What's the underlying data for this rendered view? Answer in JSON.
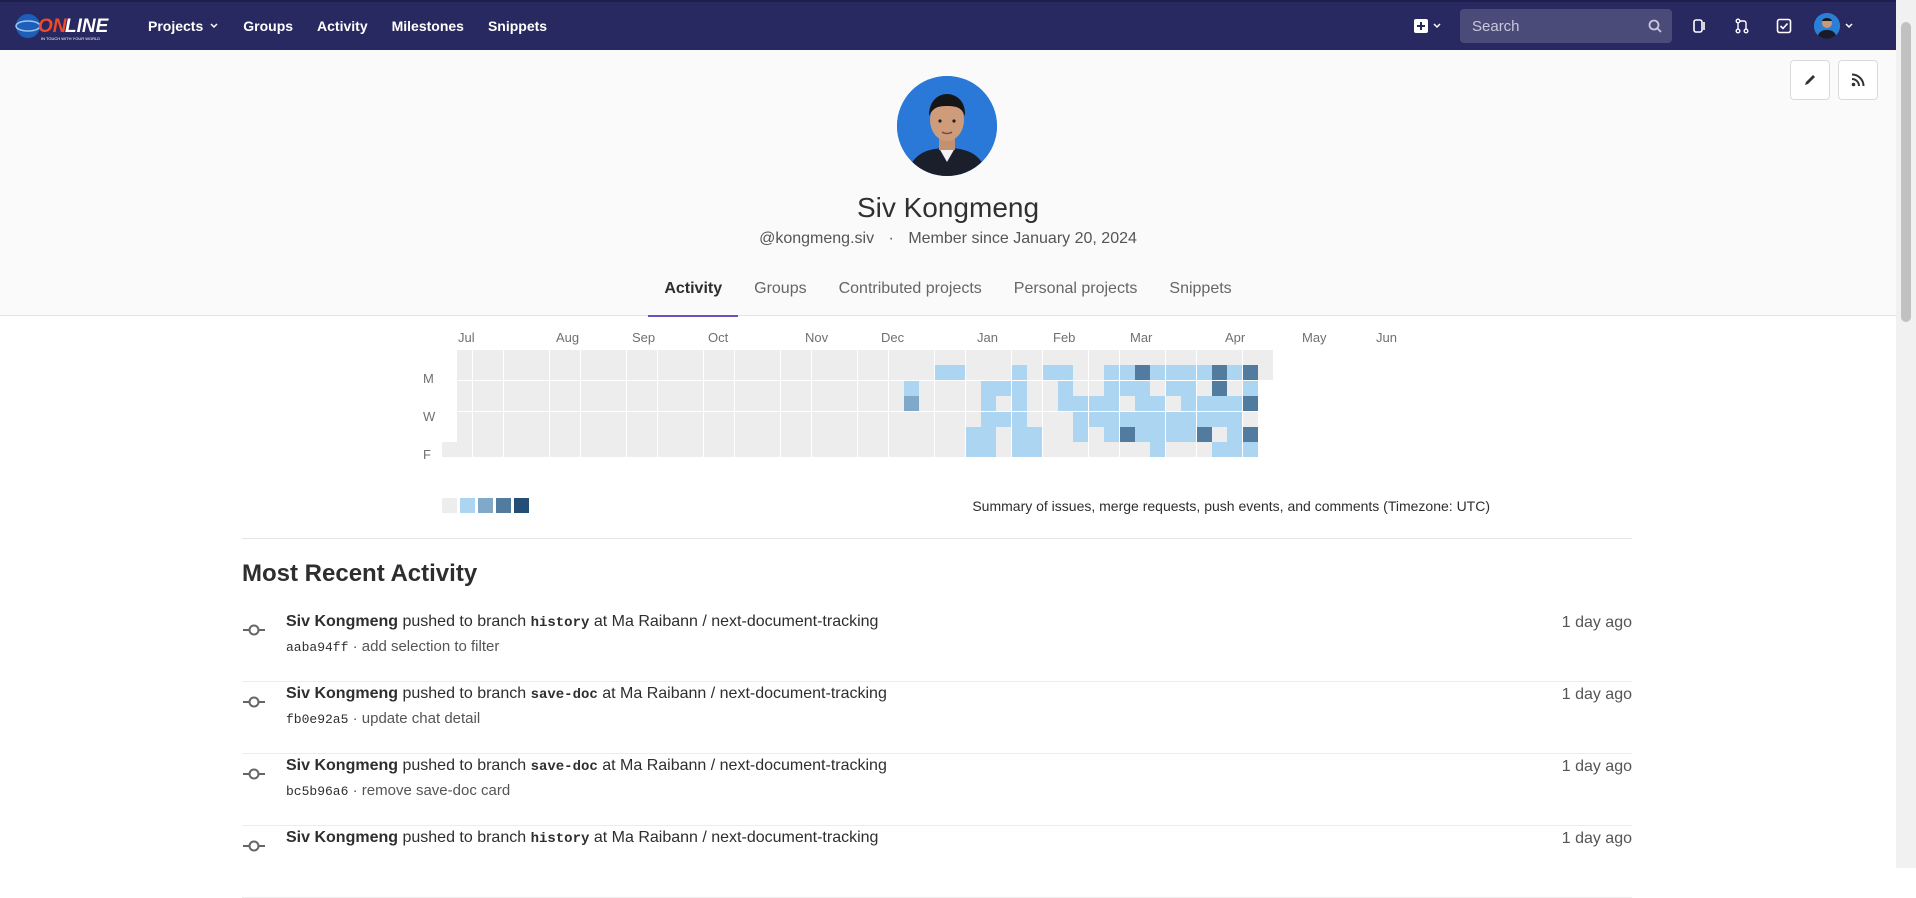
{
  "header": {
    "logo_text": "ONLINE",
    "logo_tagline": "IN TOUCH WITH YOUR WORLD",
    "nav": [
      {
        "label": "Projects",
        "dropdown": true
      },
      {
        "label": "Groups"
      },
      {
        "label": "Activity"
      },
      {
        "label": "Milestones"
      },
      {
        "label": "Snippets"
      }
    ],
    "search_placeholder": "Search"
  },
  "profile": {
    "name": "Siv Kongmeng",
    "username": "@kongmeng.siv",
    "member_since": "Member since January 20, 2024",
    "separator": "·",
    "tabs": [
      "Activity",
      "Groups",
      "Contributed projects",
      "Personal projects",
      "Snippets"
    ],
    "active_tab": "Activity"
  },
  "calendar": {
    "months": [
      "Jul",
      "Aug",
      "Sep",
      "Oct",
      "Nov",
      "Dec",
      "Jan",
      "Feb",
      "Mar",
      "Apr",
      "May",
      "Jun"
    ],
    "day_labels": [
      "M",
      "W",
      "F"
    ],
    "summary": "Summary of issues, merge requests, push events, and comments (Timezone: UTC)",
    "colors": [
      "#ededed",
      "#acd5f2",
      "#7fa8c9",
      "#527ba0",
      "#254e77"
    ]
  },
  "activity": {
    "title": "Most Recent Activity",
    "events": [
      {
        "author": "Siv Kongmeng",
        "action": "pushed to branch",
        "branch": "history",
        "at": "at",
        "project": "Ma Raibann / next-document-tracking",
        "sha": "aaba94ff",
        "message": "add selection to filter",
        "time": "1 day ago"
      },
      {
        "author": "Siv Kongmeng",
        "action": "pushed to branch",
        "branch": "save-doc",
        "at": "at",
        "project": "Ma Raibann / next-document-tracking",
        "sha": "fb0e92a5",
        "message": "update chat detail",
        "time": "1 day ago"
      },
      {
        "author": "Siv Kongmeng",
        "action": "pushed to branch",
        "branch": "save-doc",
        "at": "at",
        "project": "Ma Raibann / next-document-tracking",
        "sha": "bc5b96a6",
        "message": "remove save-doc card",
        "time": "1 day ago"
      },
      {
        "author": "Siv Kongmeng",
        "action": "pushed to branch",
        "branch": "history",
        "at": "at",
        "project": "Ma Raibann / next-document-tracking",
        "sha": "",
        "message": "",
        "time": "1 day ago"
      }
    ]
  }
}
